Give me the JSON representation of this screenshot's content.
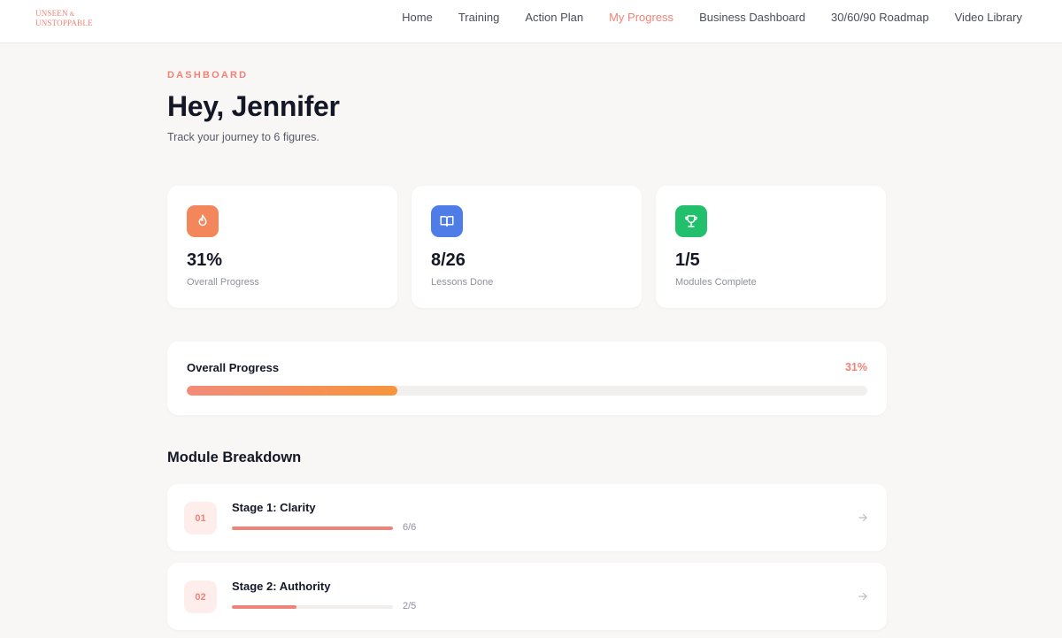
{
  "brand": {
    "line1": "UNSEEN",
    "amp": "&",
    "line2": "UNSTOPPABLE"
  },
  "nav": {
    "items": [
      {
        "label": "Home"
      },
      {
        "label": "Training"
      },
      {
        "label": "Action Plan"
      },
      {
        "label": "My Progress",
        "active": true
      },
      {
        "label": "Business Dashboard"
      },
      {
        "label": "30/60/90 Roadmap"
      },
      {
        "label": "Video Library"
      }
    ]
  },
  "header": {
    "eyebrow": "DASHBOARD",
    "greeting": "Hey, Jennifer",
    "subtitle": "Track your journey to 6 figures."
  },
  "stats": [
    {
      "icon": "flame-icon",
      "color": "#f4865c",
      "value": "31%",
      "label": "Overall Progress"
    },
    {
      "icon": "book-icon",
      "color": "#4f7de8",
      "value": "8/26",
      "label": "Lessons Done"
    },
    {
      "icon": "trophy-icon",
      "color": "#22c06d",
      "value": "1/5",
      "label": "Modules Complete"
    }
  ],
  "overall_progress": {
    "title": "Overall Progress",
    "percent_label": "31%",
    "fraction": 0.31
  },
  "modules": {
    "title": "Module Breakdown",
    "items": [
      {
        "number": "01",
        "title": "Stage 1: Clarity",
        "count": "6/6",
        "fraction": 1.0
      },
      {
        "number": "02",
        "title": "Stage 2: Authority",
        "count": "2/5",
        "fraction": 0.4
      }
    ]
  },
  "colors": {
    "accent": "#ef8378",
    "background": "#f8f7f5",
    "progress_end": "#f7953d"
  }
}
